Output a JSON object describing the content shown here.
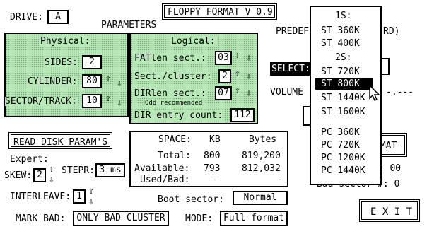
{
  "title": "FLOPPY FORMAT V 0.9",
  "drive": {
    "label": "DRIVE:",
    "value": "A"
  },
  "parameters_label": "PARAMETERS",
  "physical": {
    "title": "Physical:",
    "sides_label": "SIDES:",
    "sides": "2",
    "cylinder_label": "CYLINDER:",
    "cylinder": "80",
    "sector_label": "SECTOR/TRACK:",
    "sector": "10"
  },
  "logical": {
    "title": "Logical:",
    "fatlen_label": "FATlen sect.:",
    "fatlen": "03",
    "spc_label": "Sect./cluster:",
    "spc": "2",
    "dirlen_label": "DIRlen sect.:",
    "dirlen": "07",
    "odd_note": "Odd recommended",
    "direntry_label": "DIR entry count:",
    "direntry": "112"
  },
  "predef_label": "PREDEF",
  "predef_tail": "RD)",
  "select_label": "SELECT:",
  "volume_label": "VOLUME",
  "volume_dashes": "-.---",
  "read_disk_button": "READ DISK PARAM'S",
  "space": {
    "header_space": "SPACE:",
    "header_kb": "KB",
    "header_bytes": "Bytes",
    "total_label": "Total:",
    "total_kb": "800",
    "total_bytes": "819,200",
    "available_label": "Available:",
    "available_kb": "793",
    "available_bytes": "812,032",
    "usedbad_label": "Used/Bad:",
    "usedbad_kb": "-",
    "usedbad_bytes": "-"
  },
  "expert_label": "Expert:",
  "skew_label": "SKEW:",
  "skew": "2",
  "stepr_label": "STEPR:",
  "stepr": "3 ms",
  "interleave_label": "INTERLEAVE:",
  "interleave": "1",
  "boot_label": "Boot sector:",
  "boot": "Normal",
  "markbad_label": "MARK BAD:",
  "markbad": "ONLY BAD CLUSTER",
  "mode_label": "MODE:",
  "mode": "Full format",
  "format_button_partial": "RMAT",
  "err_partial": "R: 00",
  "badsector_partial": "Bad sector #:  0",
  "exit_button": "E X I T",
  "dropdown": {
    "items": [
      {
        "label": "1S:",
        "header": true
      },
      {
        "label": "ST 360K"
      },
      {
        "label": "ST 400K"
      },
      {
        "label": "2S:",
        "header": true
      },
      {
        "label": "ST 720K"
      },
      {
        "label": "ST 800K",
        "selected": true
      },
      {
        "label": "ST 1440K"
      },
      {
        "label": "ST 1600K"
      },
      {
        "label": "PC 360K"
      },
      {
        "label": "PC 720K"
      },
      {
        "label": "PC 1200K"
      },
      {
        "label": "PC 1440K"
      }
    ]
  }
}
